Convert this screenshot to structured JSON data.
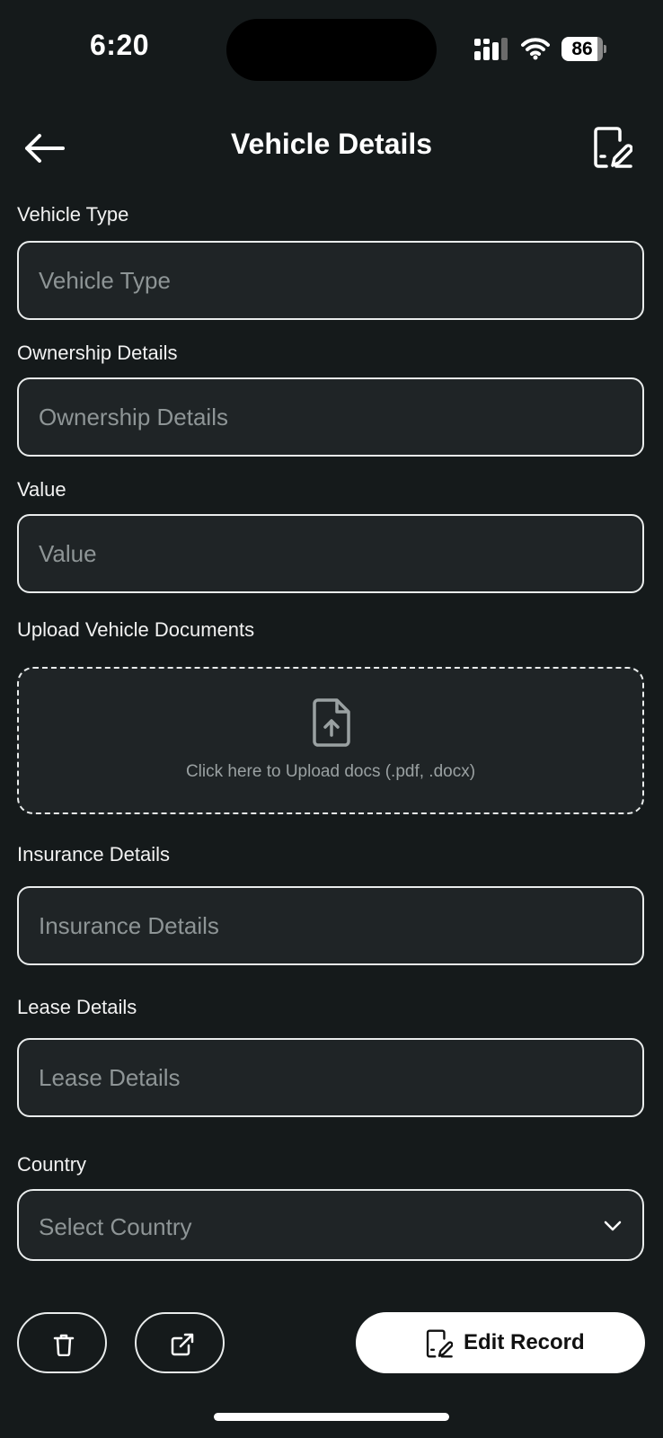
{
  "status_bar": {
    "time": "6:20",
    "battery": "86"
  },
  "header": {
    "title": "Vehicle Details"
  },
  "form": {
    "vehicle_type": {
      "label": "Vehicle Type",
      "placeholder": "Vehicle Type",
      "value": ""
    },
    "ownership": {
      "label": "Ownership Details",
      "placeholder": "Ownership Details",
      "value": ""
    },
    "value": {
      "label": "Value",
      "placeholder": "Value",
      "value": ""
    },
    "upload": {
      "label": "Upload Vehicle Documents",
      "hint": "Click here to Upload docs (.pdf, .docx)"
    },
    "insurance": {
      "label": "Insurance Details",
      "placeholder": "Insurance Details",
      "value": ""
    },
    "lease": {
      "label": "Lease Details",
      "placeholder": "Lease Details",
      "value": ""
    },
    "country": {
      "label": "Country",
      "placeholder": "Select Country"
    }
  },
  "actions": {
    "edit_label": "Edit Record"
  },
  "icons": {
    "back": "arrow-left-icon",
    "edit": "edit-document-icon",
    "upload": "file-upload-icon",
    "delete": "trash-icon",
    "share": "external-link-icon",
    "chevron": "chevron-down-icon"
  },
  "colors": {
    "background": "#151a1b",
    "field_bg": "#1f2426",
    "border": "#e9ecec",
    "placeholder": "#8e9596"
  }
}
